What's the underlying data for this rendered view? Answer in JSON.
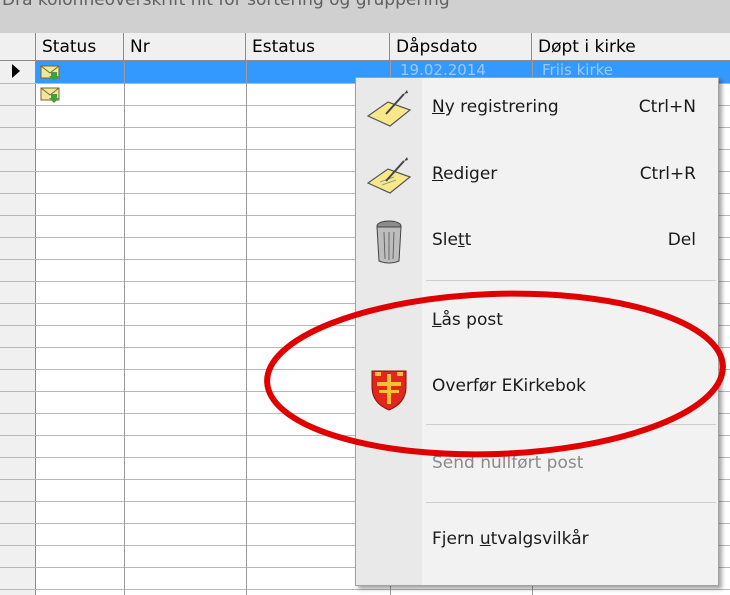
{
  "group_bar": {
    "text": "Dra kolonneoverskrift hit for sortering og gruppering"
  },
  "columns": [
    "Status",
    "Nr",
    "Estatus",
    "Dåpsdato",
    "Døpt i kirke"
  ],
  "selected_row": {
    "date": "19.02.2014",
    "church": "Friis kirke"
  },
  "row_count": 24,
  "context_menu": {
    "items": [
      {
        "label": "Ny registrering",
        "accel": "N",
        "label_rest": "y registrering",
        "shortcut": "Ctrl+N",
        "icon": "new-record-icon"
      },
      {
        "label": "Rediger",
        "accel": "R",
        "label_rest": "ediger",
        "shortcut": "Ctrl+R",
        "icon": "edit-record-icon"
      },
      {
        "label": "Slett",
        "pre": "Sle",
        "accel": "t",
        "post": "t",
        "shortcut": "Del",
        "icon": "trash-icon"
      },
      {
        "label": "Lås post",
        "accel": "L",
        "label_rest": "ås post",
        "icon": ""
      },
      {
        "label": "Overfør EKirkebok",
        "icon": "church-shield-icon"
      },
      {
        "label": "Send nullført post",
        "disabled": true,
        "icon": ""
      },
      {
        "label": "Fjern utvalgsvilkår",
        "pre": "Fjern ",
        "accel": "u",
        "post": "tvalgsvilkår",
        "icon": ""
      }
    ]
  },
  "colors": {
    "selection": "#3399ff",
    "highlight_oval": "#e00000",
    "menu_bg": "#f2f2f2"
  }
}
